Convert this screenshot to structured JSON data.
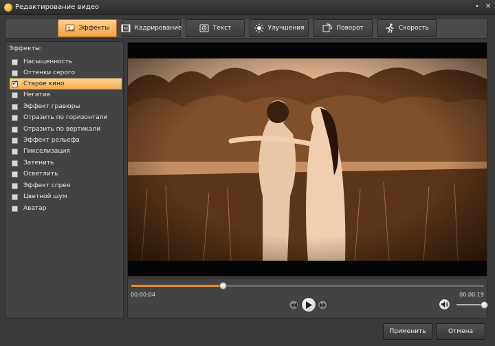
{
  "window": {
    "title": "Редактирование видео",
    "minimize_glyph": "•",
    "close_glyph": "✕",
    "app_icon": "app-logo-icon"
  },
  "tabs": [
    {
      "label": "Эффекты",
      "icon": "effects-icon",
      "active": true
    },
    {
      "label": "Кадрирование",
      "icon": "crop-icon",
      "active": false
    },
    {
      "label": "Текст",
      "icon": "text-icon",
      "active": false
    },
    {
      "label": "Улучшения",
      "icon": "enhance-sun-icon",
      "active": false
    },
    {
      "label": "Поворот",
      "icon": "rotate-icon",
      "active": false
    },
    {
      "label": "Скорость",
      "icon": "speed-runner-icon",
      "active": false
    }
  ],
  "effects_panel": {
    "heading": "Эффекты:",
    "items": [
      {
        "label": "Насыщенность",
        "checked": false
      },
      {
        "label": "Оттенки серого",
        "checked": false
      },
      {
        "label": "Старое кино",
        "checked": true
      },
      {
        "label": "Негатив",
        "checked": false
      },
      {
        "label": "Эффект гравюры",
        "checked": false
      },
      {
        "label": "Отразить по горизонтали",
        "checked": false
      },
      {
        "label": "Отразить по вертикали",
        "checked": false
      },
      {
        "label": "Эффект рельефа",
        "checked": false
      },
      {
        "label": "Пикселизация",
        "checked": false
      },
      {
        "label": "Затенить",
        "checked": false
      },
      {
        "label": "Осветлить",
        "checked": false
      },
      {
        "label": "Эффект спрея",
        "checked": false
      },
      {
        "label": "Цветной шум",
        "checked": false
      },
      {
        "label": "Аватар",
        "checked": false
      }
    ],
    "check_glyph": "✓"
  },
  "player": {
    "current_time": "00:00:04",
    "total_time": "00:00:19",
    "progress": 0.26,
    "volume": 1.0,
    "buttons": [
      "rewind-icon",
      "play-icon",
      "fast-forward-icon",
      "volume-icon"
    ]
  },
  "footer": {
    "apply_label": "Применить",
    "cancel_label": "Отмена"
  },
  "colors": {
    "accent": "#f3a349",
    "progress": "#f08c2c",
    "sepia_dark": "#3a2212",
    "sepia_light": "#e7b48a"
  }
}
